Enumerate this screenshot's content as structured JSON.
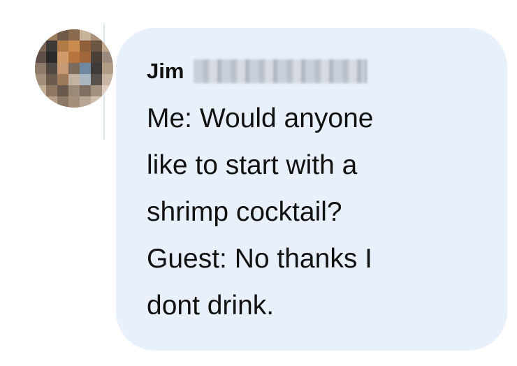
{
  "message": {
    "sender_name": "Jim",
    "lines": [
      "Me: Would anyone",
      "like to start with a",
      "shrimp cocktail?",
      "Guest: No thanks I",
      "dont drink."
    ]
  },
  "colors": {
    "bubble_background": "#e7f0fb",
    "text": "#111111"
  }
}
